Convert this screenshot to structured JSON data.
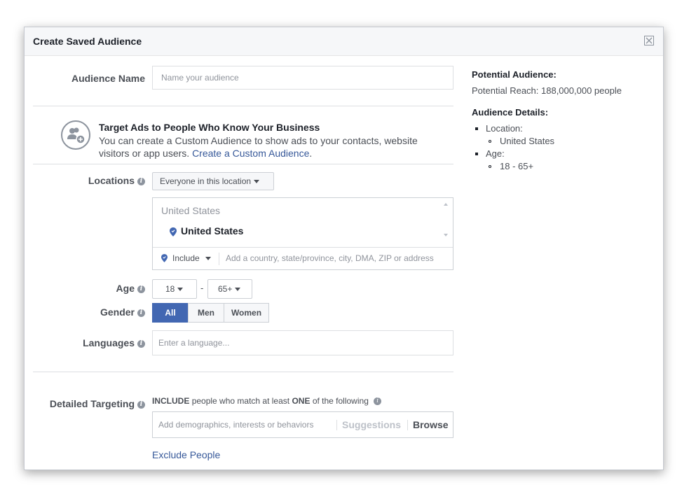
{
  "dialog": {
    "title": "Create Saved Audience",
    "close_icon": "close-icon"
  },
  "form": {
    "audience_name_label": "Audience Name",
    "audience_name_placeholder": "Name your audience",
    "custom_audience": {
      "icon": "add-people-icon",
      "title": "Target Ads to People Who Know Your Business",
      "desc_prefix": "You can create a Custom Audience to show ads to your contacts, website visitors or app users.",
      "link": "Create a Custom Audience",
      "suffix": "."
    },
    "locations_label": "Locations",
    "location_dropdown": "Everyone in this location",
    "location_group": "United States",
    "location_selected": "United States",
    "include_label": "Include",
    "location_placeholder": "Add a country, state/province, city, DMA, ZIP or address",
    "age_label": "Age",
    "age_min": "18",
    "age_sep": "-",
    "age_max": "65+",
    "gender_label": "Gender",
    "gender_options": [
      "All",
      "Men",
      "Women"
    ],
    "gender_selected": "All",
    "languages_label": "Languages",
    "languages_placeholder": "Enter a language...",
    "detailed_label": "Detailed Targeting",
    "detailed_include_bold_1": "INCLUDE",
    "detailed_include_mid": "people who match at least",
    "detailed_include_bold_2": "ONE",
    "detailed_include_end": "of the following",
    "detailed_placeholder": "Add demographics, interests or behaviors",
    "suggestions": "Suggestions",
    "browse": "Browse",
    "exclude_people": "Exclude People"
  },
  "summary": {
    "potential_title": "Potential Audience:",
    "potential_reach": "Potential Reach: 188,000,000 people",
    "details_title": "Audience Details:",
    "location_label": "Location:",
    "location_value": "United States",
    "age_label": "Age:",
    "age_value": "18 - 65+"
  },
  "colors": {
    "accent": "#4267b2",
    "link": "#365899",
    "header_bg": "#f6f7f9"
  }
}
